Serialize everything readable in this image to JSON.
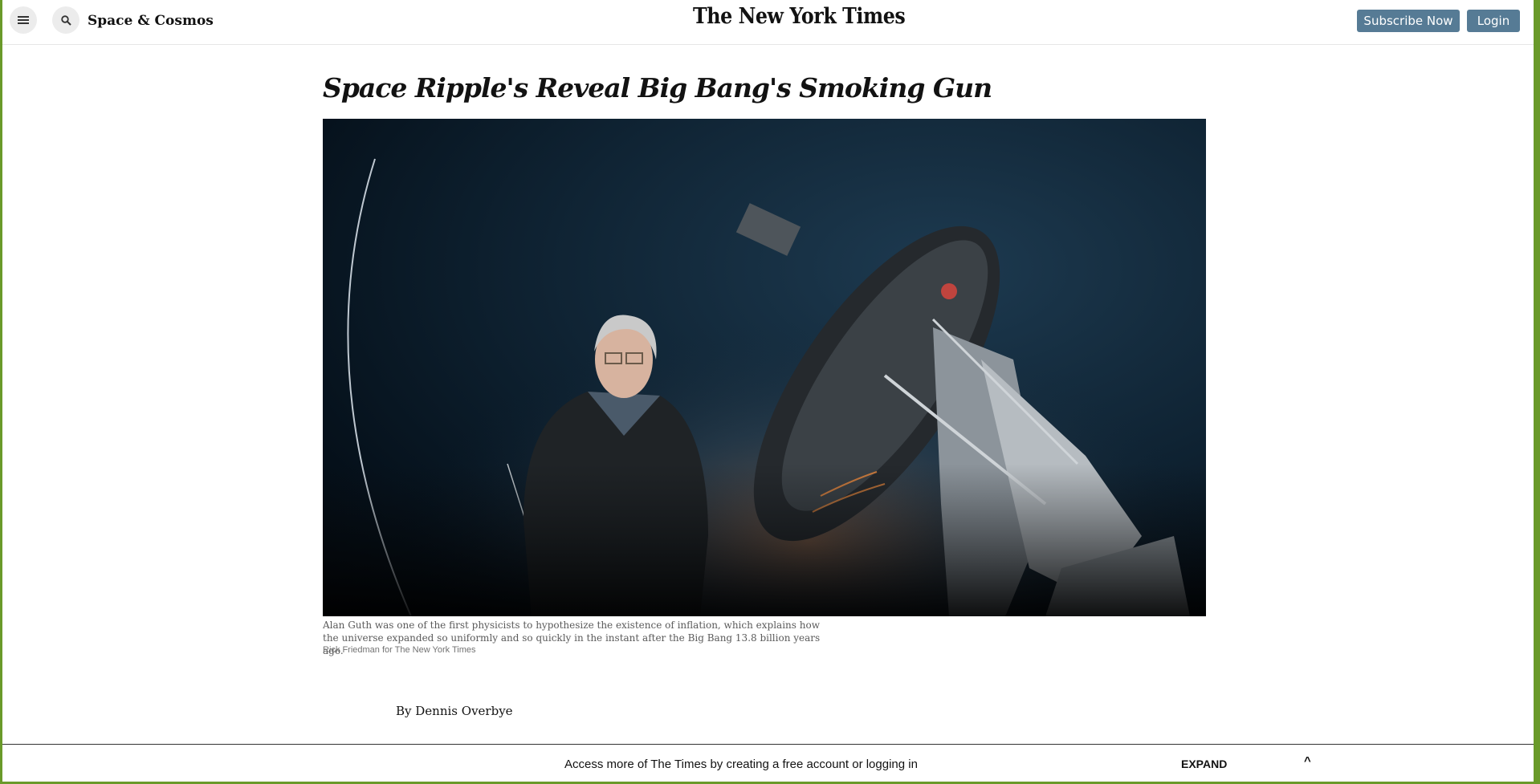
{
  "header": {
    "section_title": "Space & Cosmos",
    "masthead": "The New York Times",
    "subscribe_label": "Subscribe Now",
    "login_label": "Login",
    "menu_icon": "hamburger-menu-icon",
    "search_icon": "search-icon"
  },
  "article": {
    "headline": "Space Ripple's Reveal Big Bang's Smoking Gun",
    "image_alt": "Portrait of Alan Guth standing beside a radio telescope at dusk",
    "caption": "Alan Guth was one of the first physicists to hypothesize the existence of inflation, which explains how the universe expanded so uniformly and so quickly in the instant after the Big Bang 13.8 billion years ago.",
    "credit": "Rick Friedman for The New York Times",
    "byline_prefix": "By",
    "author": "Dennis Overbye"
  },
  "gate": {
    "message": "Access more of The Times by creating a free account or logging in",
    "expand_label": "EXPAND",
    "caret": "^"
  },
  "colors": {
    "button_bg": "#567b95",
    "page_bg": "#ffffff",
    "window_border": "#6a9a2a"
  }
}
